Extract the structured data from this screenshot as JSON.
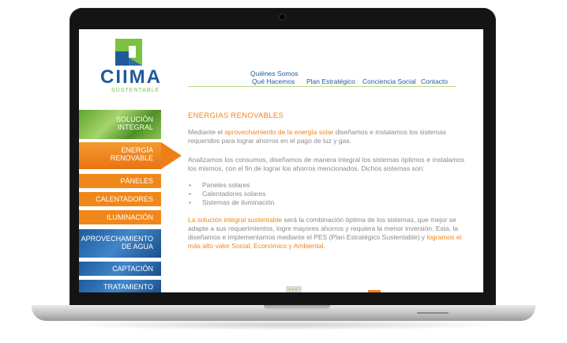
{
  "logo": {
    "name": "CIIMA",
    "tagline": "SUSTENTABLE"
  },
  "nav": {
    "quienes": "Quiénes Somos",
    "que_hacemos": "Qué Hacemos",
    "plan": "Plan Estratégico",
    "conciencia": "Conciencia Social",
    "contacto": "Contacto"
  },
  "sidebar": {
    "solucion": [
      "SOLUCIÓN",
      "INTEGRAL"
    ],
    "energia": [
      "ENERGÍA",
      "RENOVABLE"
    ],
    "paneles": "PÁNELES",
    "calentadores": "CALENTADORES",
    "iluminacion": "ILUMINACIÓN",
    "agua": [
      "APROVECHAMIENTO",
      "DE AGUA"
    ],
    "captacion": "CAPTACIÓN",
    "tratamiento": "TRATAMIENTO"
  },
  "main": {
    "title": "ENERGIAS RENOVABLES",
    "p1_a": "Mediante el ",
    "p1_hl": "aprovechamiento de la energía solar",
    "p1_b": " diseñamos e instalamos los sistemas requeridos para lograr ahorros en el pago de luz y gas.",
    "p2": "Analizamos los consumos, diseñamos de manera integral los sistemas óptimos e instalamos los mismos, con el fin de lograr los ahorros mencionados. Dichos sistemas son:",
    "bullets": [
      "Paneles solares",
      "Calentadores solares",
      "Sistemas de iluminación"
    ],
    "p3_hl1": "La solución integral sustentable",
    "p3_a": " será la combinación óptima de los sistemas, que mejor se adapte a sus requerimientos, logre mayores ahorros y requiera la menor inversión. Esta, la diseñamos e implementamos mediante el PES (Plan Estratégico Sustentable) y ",
    "p3_hl2": "logramos el más alto valor Social, Económico y Ambiental",
    "p3_end": "."
  }
}
